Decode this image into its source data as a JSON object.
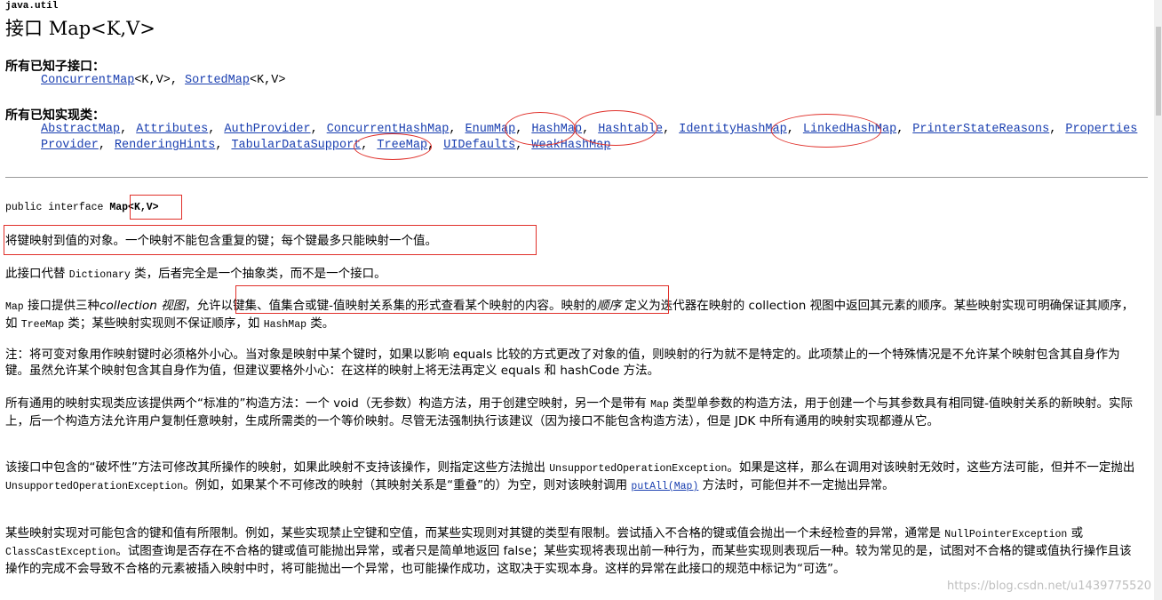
{
  "header": {
    "package": "java.util",
    "title_kind": "接口",
    "title_name": "Map<K,V>"
  },
  "subinterfaces": {
    "heading": "所有已知子接口：",
    "items": [
      {
        "link": "ConcurrentMap",
        "suffix": "<K,V>, "
      },
      {
        "link": "SortedMap",
        "suffix": "<K,V>"
      }
    ]
  },
  "implementing": {
    "heading": "所有已知实现类：",
    "row1": [
      "AbstractMap",
      "Attributes",
      "AuthProvider",
      "ConcurrentHashMap",
      "EnumMap",
      "HashMap",
      "Hashtable",
      "IdentityHashMap",
      "LinkedHashMap",
      "PrinterStateReasons",
      "Properties"
    ],
    "row2": [
      "Provider",
      "RenderingHints",
      "TabularDataSupport",
      "TreeMap",
      "UIDefaults",
      "WeakHashMap"
    ]
  },
  "declaration": {
    "prefix": "public interface ",
    "name": "Map",
    "params": "<K,V>"
  },
  "paragraphs": {
    "summary": "将键映射到值的对象。一个映射不能包含重复的键；每个键最多只能映射一个值。",
    "replace_a": "此接口代替 ",
    "replace_code": "Dictionary",
    "replace_b": " 类，后者完全是一个抽象类，而不是一个接口。",
    "views_code": "Map",
    "views_a": " 接口提供三种",
    "views_it1": "collection 视图",
    "views_b": "，",
    "views_boxed": "允许以键集、值集合或键-值映射关系集的形式查看某个映射的内容。",
    "views_c": "映射的",
    "views_it2": "顺序",
    "views_d": " 定义为迭代器在映射的 collection 视图中返回其元素的顺序。某些映射实现可明确保证其顺序，如 ",
    "views_code2": "TreeMap",
    "views_e": " 类；某些映射实现则不保证顺序，如 ",
    "views_code3": "HashMap",
    "views_f": " 类。",
    "note": "注：将可变对象用作映射键时必须格外小心。当对象是映射中某个键时，如果以影响 equals 比较的方式更改了对象的值，则映射的行为就不是特定的。此项禁止的一个特殊情况是不允许某个映射包含其自身作为键。虽然允许某个映射包含其自身作为值，但建议要格外小心：在这样的映射上将无法再定义 equals 和 hashCode 方法。",
    "ctor_a": "所有通用的映射实现类应该提供两个“标准的”构造方法：一个 void（无参数）构造方法，用于创建空映射，另一个是带有 ",
    "ctor_code": "Map",
    "ctor_b": " 类型单参数的构造方法，用于创建一个与其参数具有相同键-值映射关系的新映射。实际上，后一个构造方法允许用户复制任意映射，生成所需类的一个等价映射。尽管无法强制执行该建议（因为接口不能包含构造方法），但是 JDK 中所有通用的映射实现都遵从它。",
    "destr_a": "该接口中包含的“破坏性”方法可修改其所操作的映射，如果此映射不支持该操作，则指定这些方法抛出 ",
    "destr_code1": "UnsupportedOperationException",
    "destr_b": "。如果是这样，那么在调用对该映射无效时，这些方法可能，但并不一定抛出 ",
    "destr_code2": "UnsupportedOperationException",
    "destr_c": "。例如，如果某个不可修改的映射（其映射关系是“重叠”的）为空，则对该映射调用 ",
    "destr_link": "putAll(Map)",
    "destr_d": " 方法时，可能但并不一定抛出异常。",
    "restr_a": "某些映射实现对可能包含的键和值有所限制。例如，某些实现禁止空键和空值，而某些实现则对其键的类型有限制。尝试插入不合格的键或值会抛出一个未经检查的异常，通常是 ",
    "restr_code1": "NullPointerException",
    "restr_b": " 或 ",
    "restr_code2": "ClassCastException",
    "restr_c": "。试图查询是否存在不合格的键或值可能抛出异常，或者只是简单地返回 false；某些实现将表现出前一种行为，而某些实现则表现后一种。较为常见的是，试图对不合格的键或值执行操作且该操作的完成不会导致不合格的元素被插入映射中时，将可能抛出一个异常，也可能操作成功，这取决于实现本身。这样的异常在此接口的规范中标记为“可选”。"
  },
  "watermark": "https://blog.csdn.net/u1439775520",
  "colors": {
    "link": "#1a3fb0",
    "annotation": "#e0302a"
  }
}
